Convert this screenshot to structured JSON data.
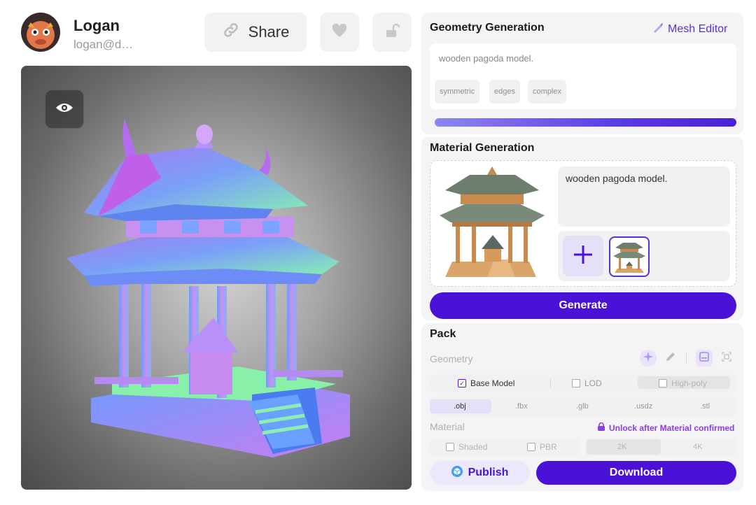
{
  "user": {
    "name": "Logan",
    "email": "logan@d…"
  },
  "toolbar": {
    "share_label": "Share"
  },
  "geometry": {
    "title": "Geometry Generation",
    "mesh_editor_label": "Mesh Editor",
    "prompt": "wooden pagoda model.",
    "tags": [
      "symmetric",
      "edges",
      "complex"
    ],
    "progress": 1.0
  },
  "material": {
    "title": "Material Generation",
    "prompt": "wooden pagoda model.",
    "generate_label": "Generate"
  },
  "pack": {
    "title": "Pack",
    "geometry_label": "Geometry",
    "options": [
      {
        "label": "Base Model",
        "checked": true
      },
      {
        "label": "LOD",
        "checked": false
      },
      {
        "label": "High-poly",
        "checked": false
      }
    ],
    "formats": [
      ".obj",
      ".fbx",
      ".glb",
      ".usdz",
      ".stl"
    ],
    "selected_format": ".obj",
    "material_label": "Material",
    "unlock_label": "Unlock after Material confirmed",
    "material_options": [
      {
        "label": "Shaded",
        "checked": false
      },
      {
        "label": "PBR",
        "checked": false
      }
    ],
    "resolutions": [
      "2K",
      "4K"
    ],
    "selected_resolution": "2K",
    "publish_label": "Publish",
    "download_label": "Download"
  },
  "colors": {
    "accent": "#4a12d6",
    "accent_light": "#e4e0f8",
    "lock": "#8a3ee8"
  }
}
